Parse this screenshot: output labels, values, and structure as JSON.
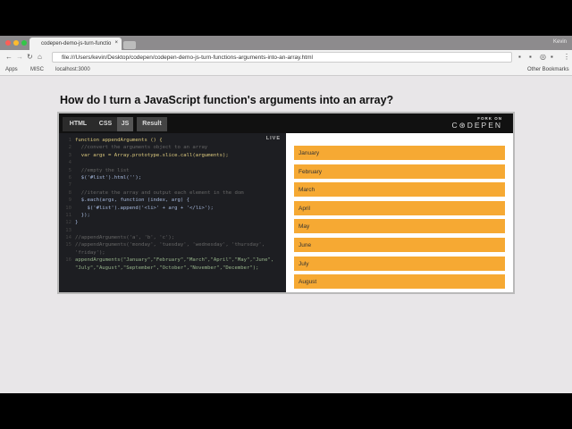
{
  "browser": {
    "tab_title": "codepen-demo-js-turn-functio",
    "user": "Kevin",
    "url": "file:///Users/kevin/Desktop/codepen/codepen-demo-js-turn-functions-arguments-into-an-array.html",
    "bookmarks": [
      "Apps",
      "MISC",
      "localhost:3000"
    ],
    "other_bookmarks": "Other Bookmarks"
  },
  "page": {
    "heading": "How do I turn a JavaScript function's arguments into an array?"
  },
  "embed": {
    "tabs": [
      "HTML",
      "CSS",
      "JS",
      "Result"
    ],
    "active_tab": "JS",
    "fork_small": "FORK ON",
    "fork_brand": "C⊛DEPEN",
    "live": "LIVE",
    "code": [
      "function appendArguments () {",
      "  //convert the arguments object to an array",
      "  var args = Array.prototype.slice.call(arguments);",
      "",
      "  //empty the list",
      "  $('#list').html('');",
      "",
      "  //iterate the array and output each element in the dom",
      "  $.each(args, function (index, arg) {",
      "    $('#list').append('<li>' + arg + '</li>');",
      "  });",
      "}",
      "",
      "//appendArguments('a', 'b', 'c');",
      "//appendArguments('monday', 'tuesday', 'wednesday', 'thursday',",
      "'friday');",
      "appendArguments(\"January\",\"February\",\"March\",\"April\",\"May\",\"June\",",
      "\"July\",\"August\",\"September\",\"October\",\"November\",\"December\");"
    ],
    "line_numbers": [
      "1",
      "2",
      "3",
      "4",
      "5",
      "6",
      "7",
      "8",
      "9",
      "10",
      "11",
      "12",
      "13",
      "14",
      "15",
      "",
      "16",
      ""
    ],
    "result_items": [
      "January",
      "February",
      "March",
      "April",
      "May",
      "June",
      "July",
      "August"
    ],
    "item_color": "#f6a933"
  }
}
